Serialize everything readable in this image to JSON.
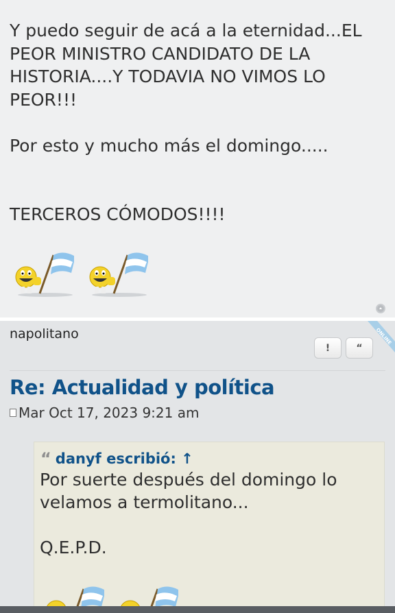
{
  "post1": {
    "lines": [
      "Y puedo seguir de acá a la eternidad...EL",
      "PEOR MINISTRO CANDIDATO DE LA",
      "HISTORIA....Y TODAVIA NO VIMOS LO",
      "PEOR!!!",
      "",
      "Por esto y mucho más el domingo.....",
      "",
      "",
      "TERCEROS CÓMODOS!!!!"
    ],
    "smileys": [
      "argentina-flag-smiley",
      "argentina-flag-smiley"
    ]
  },
  "post2": {
    "author": "napolitano",
    "ribbon_label": "ONLINE",
    "report_label": "!",
    "quote_label": "“",
    "title": "Re: Actualidad y política",
    "date": "Mar Oct 17, 2023 9:21 am",
    "quote": {
      "author_line": "danyf escribió: ↑",
      "lines": [
        "Por suerte después del domingo lo",
        "velamos a termolitano...",
        "",
        "Q.E.P.D."
      ]
    }
  },
  "colors": {
    "title": "#105289",
    "quote_bg": "#ebeadd",
    "post_bg": "#e3e5e7"
  }
}
